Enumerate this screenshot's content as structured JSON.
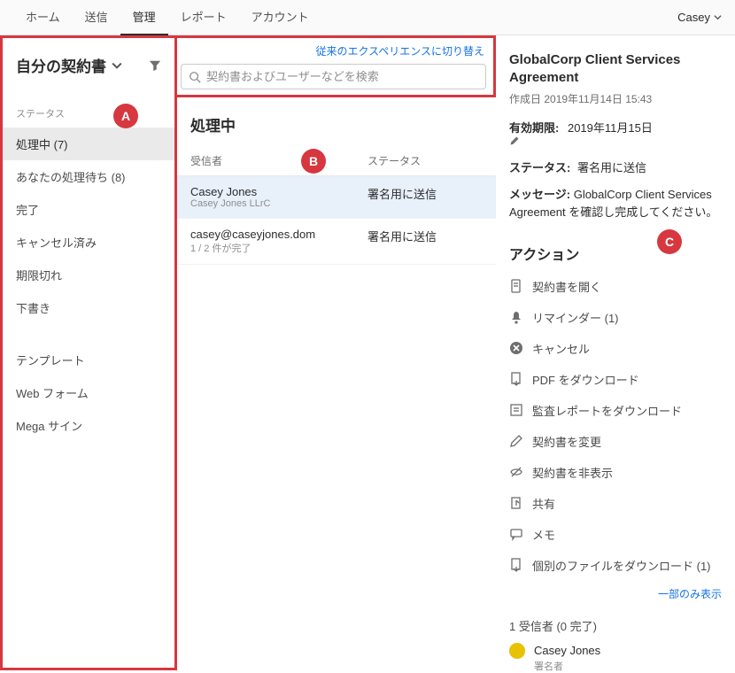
{
  "nav": {
    "items": [
      "ホーム",
      "送信",
      "管理",
      "レポート",
      "アカウント"
    ],
    "active_index": 2,
    "user": "Casey"
  },
  "sidebar": {
    "title": "自分の契約書",
    "status_label": "ステータス",
    "items": [
      {
        "label": "処理中 (7)",
        "active": true
      },
      {
        "label": "あなたの処理待ち (8)"
      },
      {
        "label": "完了"
      },
      {
        "label": "キャンセル済み"
      },
      {
        "label": "期限切れ"
      },
      {
        "label": "下書き"
      }
    ],
    "secondary": [
      {
        "label": "テンプレート"
      },
      {
        "label": "Web フォーム"
      },
      {
        "label": "Mega サイン"
      }
    ]
  },
  "switch_link": "従来のエクスペリエンスに切り替え",
  "search": {
    "placeholder": "契約書およびユーザーなどを検索"
  },
  "list": {
    "title": "処理中",
    "col_recipient": "受信者",
    "col_status": "ステータス",
    "rows": [
      {
        "name": "Casey Jones",
        "sub": "Casey Jones LLrC",
        "status": "署名用に送信",
        "selected": true
      },
      {
        "name": "casey@caseyjones.dom",
        "sub": "1 / 2 件が完了",
        "status": "署名用に送信",
        "selected": false
      }
    ]
  },
  "detail": {
    "title": "GlobalCorp Client Services Agreement",
    "created_label": "作成日",
    "created_value": "2019年11月14日 15:43",
    "expire_label": "有効期限:",
    "expire_value": "2019年11月15日",
    "status_label": "ステータス:",
    "status_value": "署名用に送信",
    "message_label": "メッセージ:",
    "message_value": "GlobalCorp Client Services Agreement を確認し完成してください。"
  },
  "actions": {
    "header": "アクション",
    "items": [
      {
        "icon": "doc",
        "label": "契約書を開く"
      },
      {
        "icon": "bell",
        "label": "リマインダー (1)"
      },
      {
        "icon": "cancel",
        "label": "キャンセル"
      },
      {
        "icon": "pdf",
        "label": "PDF をダウンロード"
      },
      {
        "icon": "audit",
        "label": "監査レポートをダウンロード"
      },
      {
        "icon": "edit",
        "label": "契約書を変更"
      },
      {
        "icon": "hide",
        "label": "契約書を非表示"
      },
      {
        "icon": "share",
        "label": "共有"
      },
      {
        "icon": "note",
        "label": "メモ"
      },
      {
        "icon": "dlfile",
        "label": "個別のファイルをダウンロード (1)"
      }
    ],
    "show_less": "一部のみ表示"
  },
  "recipients": {
    "summary": "1 受信者 (0 完了)",
    "list": [
      {
        "name": "Casey Jones",
        "role": "署名者"
      }
    ]
  },
  "badges": {
    "a": "A",
    "b": "B",
    "c": "C"
  }
}
